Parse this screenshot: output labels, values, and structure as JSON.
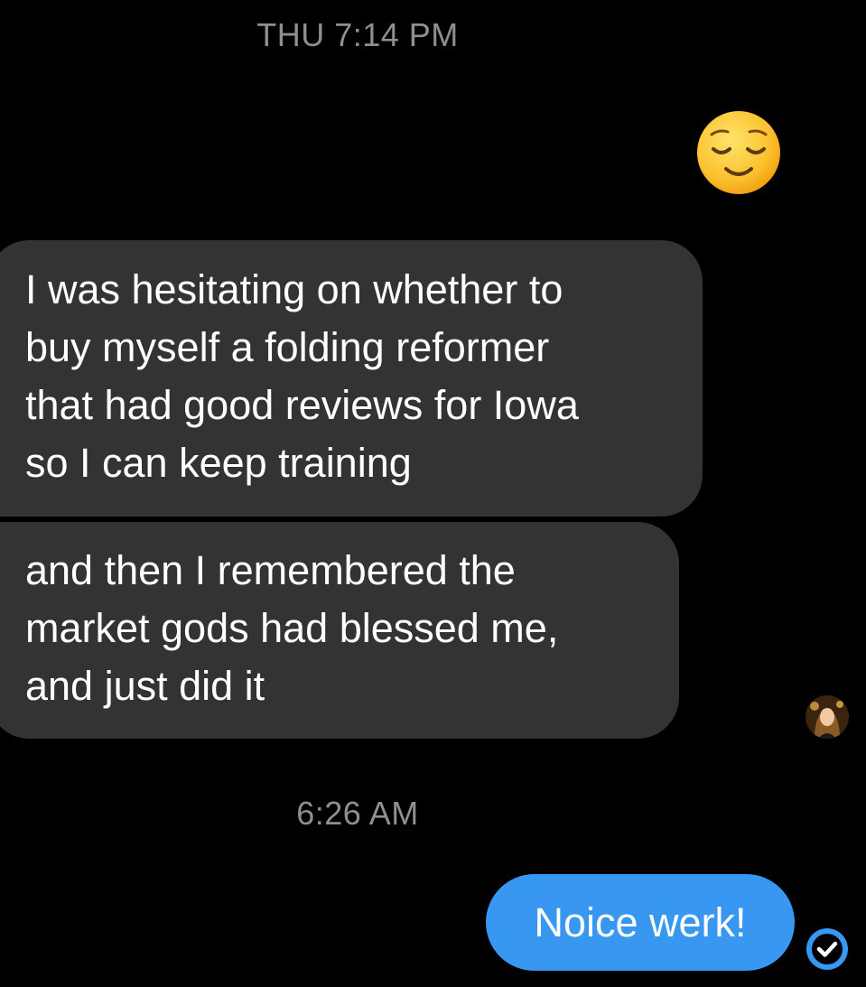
{
  "conversation": {
    "timestamps": [
      "THU 7:14 PM",
      "6:26 AM"
    ],
    "messages": [
      {
        "sender": "me",
        "type": "emoji",
        "emoji": "relieved-face"
      },
      {
        "sender": "them",
        "type": "text",
        "text": "I was hesitating on whether to\nbuy myself a folding reformer\nthat had good reviews for Iowa\nso I can keep  training"
      },
      {
        "sender": "them",
        "type": "text",
        "text": "and then I remembered the\nmarket gods had blessed me,\nand just did it"
      },
      {
        "sender": "me",
        "type": "text",
        "text": "Noice werk!"
      }
    ]
  },
  "icons": {
    "avatar": "contact-avatar",
    "read_receipt": "checkmark-circle-icon"
  },
  "colors": {
    "background": "#000000",
    "incoming_bubble": "#333335",
    "outgoing_bubble": "#3897f0",
    "timestamp_text": "#8e8e93"
  }
}
